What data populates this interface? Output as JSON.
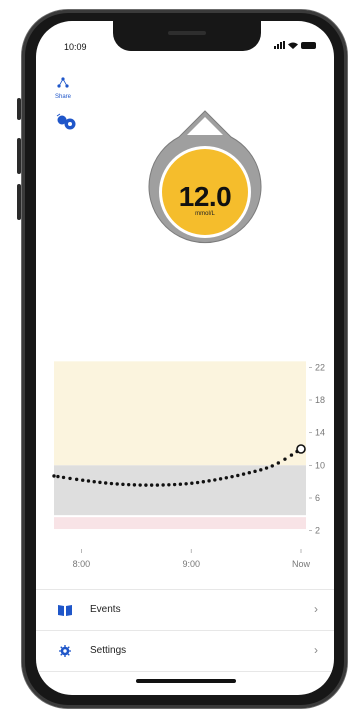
{
  "status_bar": {
    "time": "10:09"
  },
  "toolbar": {
    "share_label": "Share"
  },
  "reading": {
    "value": "12.0",
    "unit": "mmol/L",
    "color": "#f5bd2c"
  },
  "chart_data": {
    "type": "line",
    "x_tick_labels": [
      "8:00",
      "9:00",
      "Now"
    ],
    "y_tick_labels": [
      "22",
      "18",
      "14",
      "10",
      "6",
      "2"
    ],
    "ylim": [
      0,
      24
    ],
    "target_range": [
      3.9,
      10
    ],
    "high_zone": [
      10,
      22
    ],
    "low_zone": [
      0,
      3.9
    ],
    "x": [
      "7:45",
      "8:00",
      "8:15",
      "8:30",
      "8:45",
      "9:00",
      "9:15",
      "9:30",
      "9:45",
      "10:00"
    ],
    "values": [
      8.7,
      8.2,
      7.8,
      7.6,
      7.6,
      7.8,
      8.3,
      9.0,
      10.0,
      12.0
    ],
    "colors": {
      "high_zone": "#fbf4de",
      "target": "#dedede",
      "low_zone": "#f8e3e6",
      "line": "#111111"
    }
  },
  "menu": {
    "items": [
      {
        "label": "Events",
        "icon": "book-icon"
      },
      {
        "label": "Settings",
        "icon": "gear-icon"
      }
    ]
  }
}
